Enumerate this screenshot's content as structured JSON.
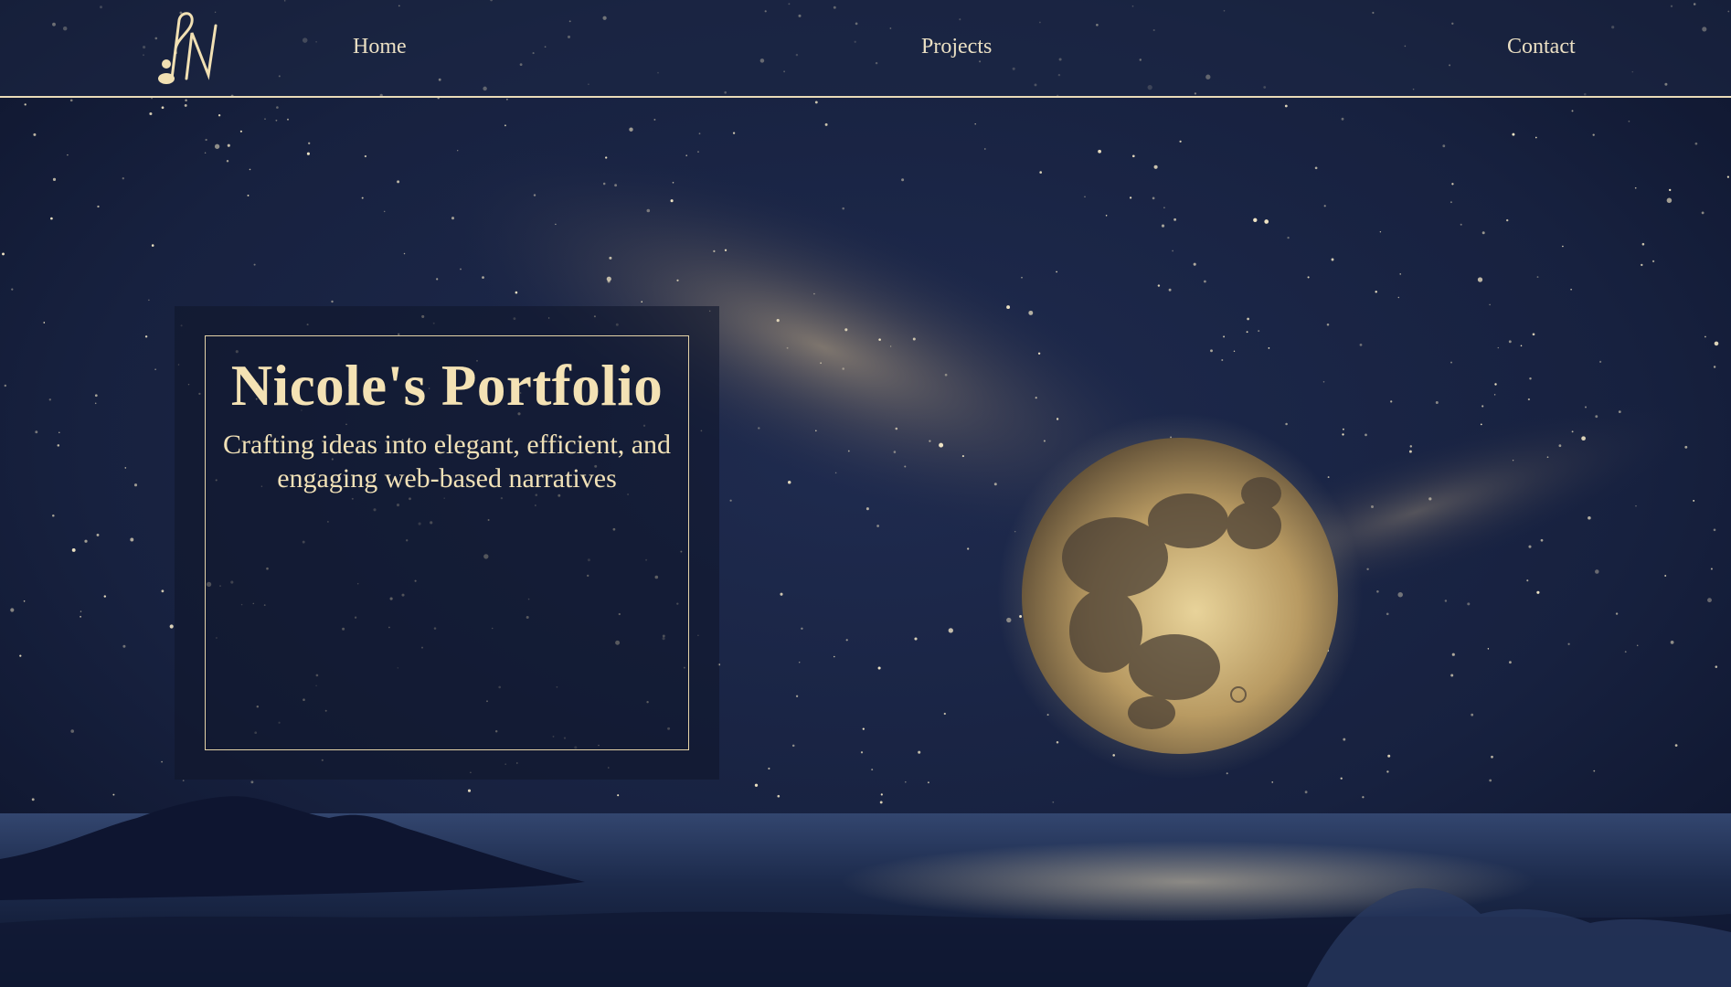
{
  "header": {
    "logo_icon": "monogram-music-note-icon",
    "nav": {
      "home": "Home",
      "projects": "Projects",
      "contact": "Contact"
    }
  },
  "hero": {
    "title": "Nicole's Portfolio",
    "subtitle": "Crafting ideas into elegant, efficient, and engaging web-based narratives"
  },
  "background": {
    "scene": "night-sky-moon-ocean",
    "colors": {
      "sky": "#141c35",
      "accent_gold": "#f4e2b4",
      "border_gold": "#e4d3a8"
    }
  }
}
